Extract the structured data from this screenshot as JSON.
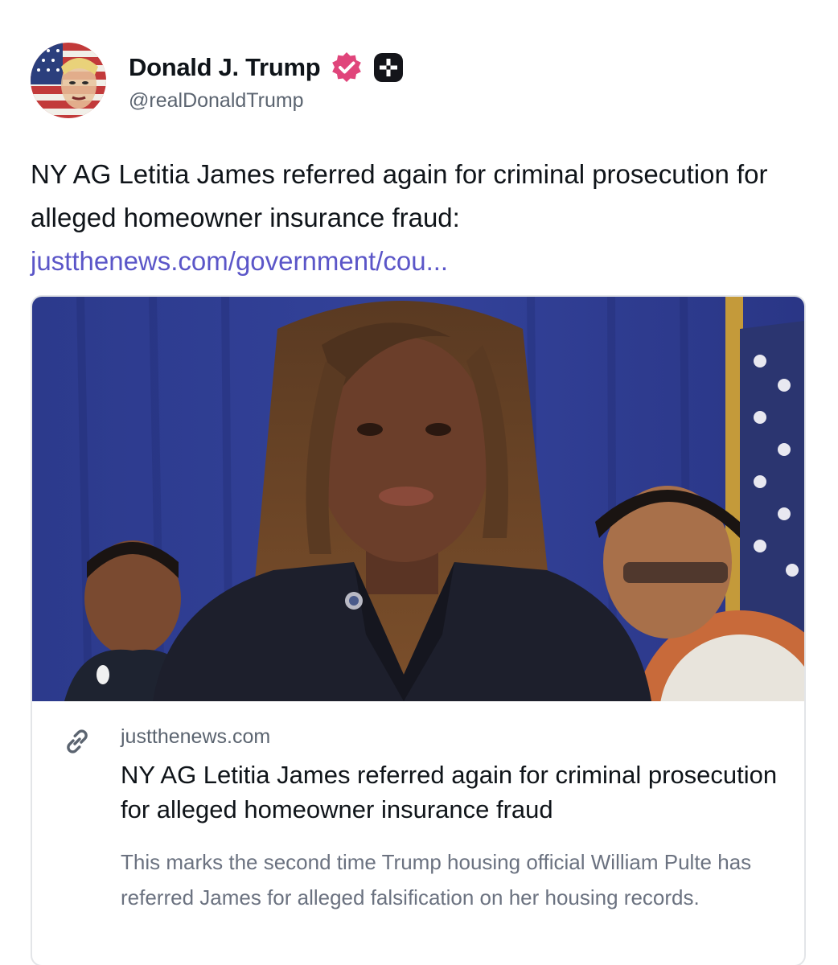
{
  "author": {
    "display_name": "Donald J. Trump",
    "handle": "@realDonaldTrump",
    "avatar_icon": "avatar-flag-portrait",
    "verified_icon": "verified-badge-icon",
    "badge_icon": "plus-badge-icon"
  },
  "post": {
    "text": "NY AG Letitia James referred again for criminal prosecution for alleged homeowner insurance fraud:",
    "link_text": "justthenews.com/government/cou..."
  },
  "link_card": {
    "domain": "justthenews.com",
    "title": "NY AG Letitia James referred again for criminal prosecution for alleged homeowner insurance fraud",
    "description": "This marks the second time Trump housing official William Pulte has referred James for alleged falsification on her housing records.",
    "link_icon": "chain-link-icon"
  },
  "colors": {
    "link": "#5b56c8",
    "verified": "#e0457b",
    "text": "#0f1419",
    "muted": "#5b6470"
  }
}
